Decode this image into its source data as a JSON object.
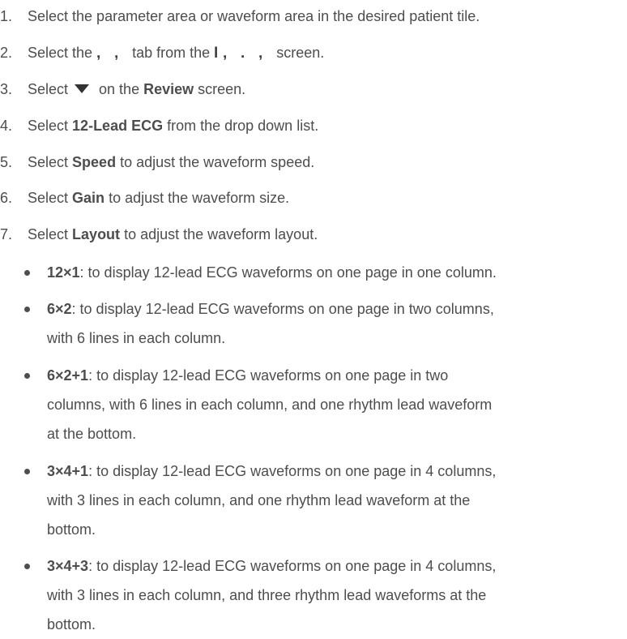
{
  "steps": [
    {
      "num": "1.",
      "text": "Select the parameter area or waveform area in the desired patient tile."
    },
    {
      "num": "2.",
      "pre": "Select the",
      "tab_glyph": ", ,",
      "mid": "tab from the",
      "screen_glyph": "l,  . ,",
      "post": "screen."
    },
    {
      "num": "3.",
      "pre": "Select",
      "icon": "down-triangle-icon",
      "mid": "on the",
      "bold": "Review",
      "post": "screen."
    },
    {
      "num": "4.",
      "pre": "Select",
      "bold": "12-Lead ECG",
      "post": "from the drop down list."
    },
    {
      "num": "5.",
      "pre": "Select",
      "bold": "Speed",
      "post": "to adjust the waveform speed."
    },
    {
      "num": "6.",
      "pre": "Select",
      "bold": "Gain",
      "post": "to adjust the waveform size."
    },
    {
      "num": "7.",
      "pre": "Select",
      "bold": "Layout",
      "post": "to adjust the waveform layout."
    }
  ],
  "layouts": [
    {
      "name": "12×1",
      "lines": [
        ": to display 12-lead ECG waveforms on one page in one column."
      ]
    },
    {
      "name": "6×2",
      "lines": [
        ": to display 12-lead ECG waveforms on one page in two columns,",
        "with 6 lines in each column."
      ]
    },
    {
      "name": "6×2+1",
      "lines": [
        ": to display 12-lead ECG waveforms on one page in two",
        "columns, with 6 lines in each column, and one rhythm lead waveform",
        "at the bottom."
      ]
    },
    {
      "name": "3×4+1",
      "lines": [
        ": to display 12-lead ECG waveforms on one page in 4 columns,",
        "with 3 lines in each column, and one rhythm lead waveform at the",
        "bottom."
      ]
    },
    {
      "name": "3×4+3",
      "lines": [
        ": to display 12-lead ECG waveforms on one page in 4 columns,",
        "with 3 lines in each column, and three rhythm lead waveforms at the",
        "bottom."
      ]
    }
  ]
}
